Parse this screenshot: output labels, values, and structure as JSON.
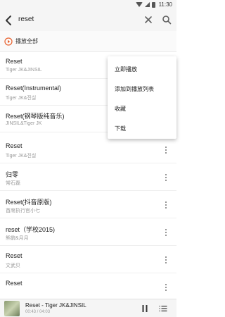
{
  "status_bar": {
    "time": "11:30"
  },
  "search": {
    "query": "reset"
  },
  "play_all": {
    "label": "播放全部"
  },
  "songs": [
    {
      "title": "Reset",
      "artist": "Tiger JK&JINSIL"
    },
    {
      "title": "Reset(Instrumental)",
      "artist": "Tiger JK&진실"
    },
    {
      "title": "Reset(钢琴版纯音乐)",
      "artist": "JINSIL&Tiger JK"
    },
    {
      "title": "Reset",
      "artist": "Tiger JK&진실"
    },
    {
      "title": "归零",
      "artist": "常石磊"
    },
    {
      "title": "Reset(抖音原版)",
      "artist": "首席执行官小七"
    },
    {
      "title": "reset（学校2015)",
      "artist": "熊貌&月月"
    },
    {
      "title": "Reset",
      "artist": "文武贝"
    },
    {
      "title": "Reset",
      "artist": ""
    }
  ],
  "context_menu": {
    "items": [
      "立即播放",
      "添加到播放列表",
      "收藏",
      "下载"
    ]
  },
  "now_playing": {
    "title": "Reset - Tiger JK&JINSIL",
    "time": "00:43 / 04:03"
  },
  "colors": {
    "accent": "#e8602c",
    "icon": "#616161"
  }
}
